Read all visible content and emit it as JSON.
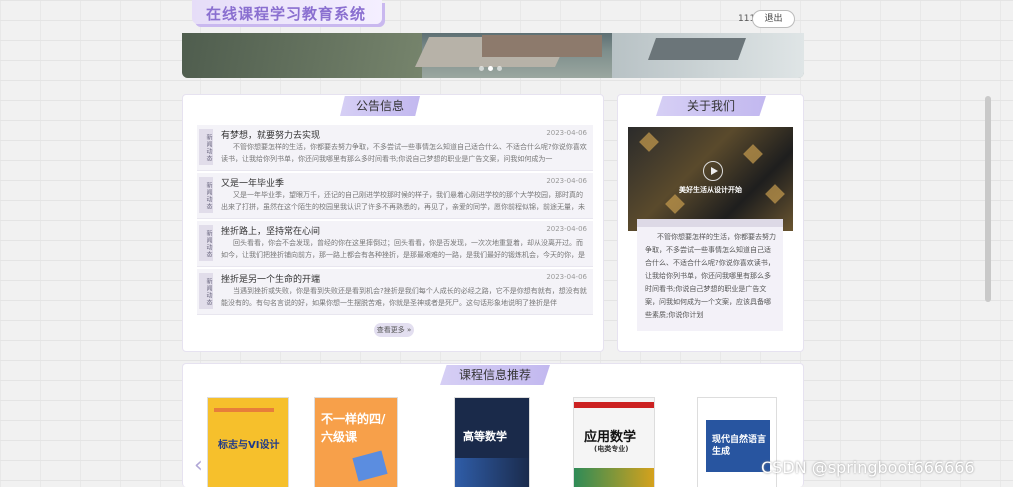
{
  "header": {
    "title": "在线课程学习教育系统",
    "user_name": "111",
    "logout_label": "退出"
  },
  "banner": {
    "dots": [
      false,
      true,
      false
    ]
  },
  "notice": {
    "title": "公告信息",
    "items": [
      {
        "tag": "新闻动态",
        "title": "有梦想，就要努力去实现",
        "date": "2023-04-06",
        "body": "不管你想要怎样的生活，你都要去努力争取，不多尝试一些事情怎么知道自己适合什么、不适合什么呢?你说你喜欢读书，让我给你列书单，你还问我哪里有那么多时间看书;你说自己梦想的职业是广告文案，问我如何成为一"
      },
      {
        "tag": "新闻动态",
        "title": "又是一年毕业季",
        "date": "2023-04-06",
        "body": "又是一年毕业季，望眼万千，还记的自己刚进学校那时候的样子，我们悬着心刚进学校的那个大学校园，那时真的出来了打拼，虽然在这个陌生的校园里我认识了许多不再熟悉的，再见了，亲爱的同学，愿你前程似锦，前途无量，未来可期，也许很久都不会再相见"
      },
      {
        "tag": "新闻动态",
        "title": "挫折路上，坚持常在心间",
        "date": "2023-04-06",
        "body": "回头看看，你会不会发现，曾经的你在这里摔倒过；回头看看，你是否发现，一次次地重复着，却从没离开过。而如今，让我们把挫折铺向前方，那一路上都会有各种挫折，是那最艰难的一路，是我们最好的锻炼机会，今天的你，是"
      },
      {
        "tag": "新闻动态",
        "title": "挫折是另一个生命的开端",
        "date": "2023-04-06",
        "body": "当遇到挫折或失败，你是看到失败还是看到机会?挫折是我们每个人成长的必经之路，它不是你想有就有，想没有就能没有的。有句名言说的好，如果你想一生摆脱苦难，你就是圣神或者是死尸。这句话形象地说明了挫折是伴"
      }
    ],
    "more_label": "查看更多"
  },
  "about": {
    "title": "关于我们",
    "image_caption": "美好生活从设计开始",
    "text": "不管你想要怎样的生活，你都要去努力争取，不多尝试一些事情怎么知道自己适合什么、不适合什么呢?你说你喜欢读书，让我给你列书单，你还问我哪里有那么多时间看书;你说自己梦想的职业是广告文案，问我如何成为一个文案，应该具备哪些素质;你说你计划"
  },
  "courses": {
    "title": "课程信息推荐",
    "books": [
      {
        "title": "标志与VI设计"
      },
      {
        "title": "不一样的四/六级课"
      },
      {
        "title": "高等数学"
      },
      {
        "title": "应用数学",
        "subtitle": "(电类专业)"
      },
      {
        "title": "现代自然语言生成"
      }
    ]
  },
  "watermark": "CSDN @springboot666666",
  "colors": {
    "accent": "#c2b8ef",
    "title_text": "#8a6fd0"
  }
}
